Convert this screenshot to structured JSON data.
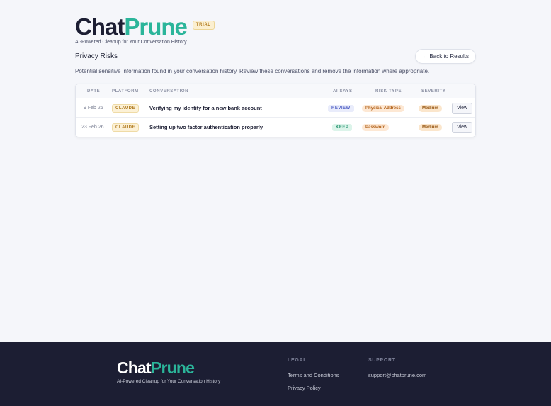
{
  "brand": {
    "logo_part1": "Chat",
    "logo_part2": "Prune",
    "badge": "TRIAL",
    "tagline": "AI-Powered Cleanup for Your Conversation History"
  },
  "page": {
    "title": "Privacy Risks",
    "back_label": "← Back to Results",
    "description": "Potential sensitive information found in your conversation history. Review these conversations and remove the information where appropriate."
  },
  "table": {
    "columns": [
      "DATE",
      "PLATFORM",
      "CONVERSATION",
      "AI SAYS",
      "RISK TYPE",
      "SEVERITY"
    ],
    "rows": [
      {
        "date": "9 Feb 26",
        "platform": "CLAUDE",
        "conversation": "Verifying my identity for a new bank account",
        "ai_says": "REVIEW",
        "risk_type": "Physical Address",
        "severity": "Medium",
        "action": "View"
      },
      {
        "date": "23 Feb 26",
        "platform": "CLAUDE",
        "conversation": "Setting up two factor authentication properly",
        "ai_says": "KEEP",
        "risk_type": "Password",
        "severity": "Medium",
        "action": "View"
      }
    ]
  },
  "footer": {
    "logo_part1": "Chat",
    "logo_part2": "Prune",
    "tagline": "AI-Powered Cleanup for Your Conversation History",
    "legal_heading": "LEGAL",
    "legal_links": [
      "Terms and Conditions",
      "Privacy Policy"
    ],
    "support_heading": "SUPPORT",
    "support_email": "support@chatprune.com"
  },
  "colors": {
    "accent": "#2bb59a",
    "dark": "#1c1e33",
    "background": "#f5f6fa"
  }
}
